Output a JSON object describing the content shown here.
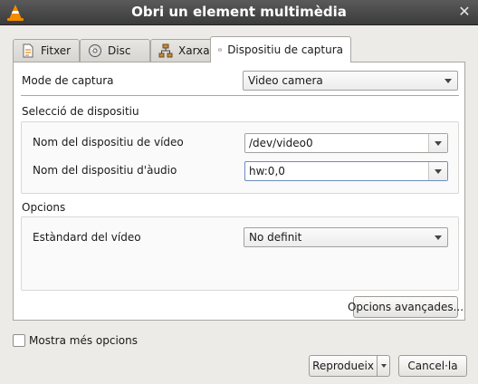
{
  "window": {
    "title": "Obri un element multimèdia",
    "app_icon": "vlc-cone-icon",
    "close_icon": "close-icon"
  },
  "tabs": [
    {
      "label": "Fitxer",
      "icon": "file-icon"
    },
    {
      "label": "Disc",
      "icon": "disc-icon"
    },
    {
      "label": "Xarxa",
      "icon": "network-icon"
    },
    {
      "label": "Dispositiu de captura",
      "icon": "capture-device-icon",
      "active": true
    }
  ],
  "capture": {
    "mode_label": "Mode de captura",
    "mode_value": "Video camera"
  },
  "device_selection": {
    "heading": "Selecció de dispositiu",
    "video_label": "Nom del dispositiu de vídeo",
    "video_value": "/dev/video0",
    "audio_label": "Nom del dispositiu d'àudio",
    "audio_value": "hw:0,0"
  },
  "options": {
    "heading": "Opcions",
    "standard_label": "Estàndard del vídeo",
    "standard_value": "No definit",
    "advanced_button": "Opcions avançades..."
  },
  "footer": {
    "more_options": "Mostra més opcions",
    "more_options_checked": false,
    "play_button": "Reprodueix",
    "cancel_button": "Cancel·la"
  },
  "colors": {
    "titlebar": "#3b3b3b",
    "accent_cone": "#f08c00",
    "focus": "#6c8cbf"
  }
}
